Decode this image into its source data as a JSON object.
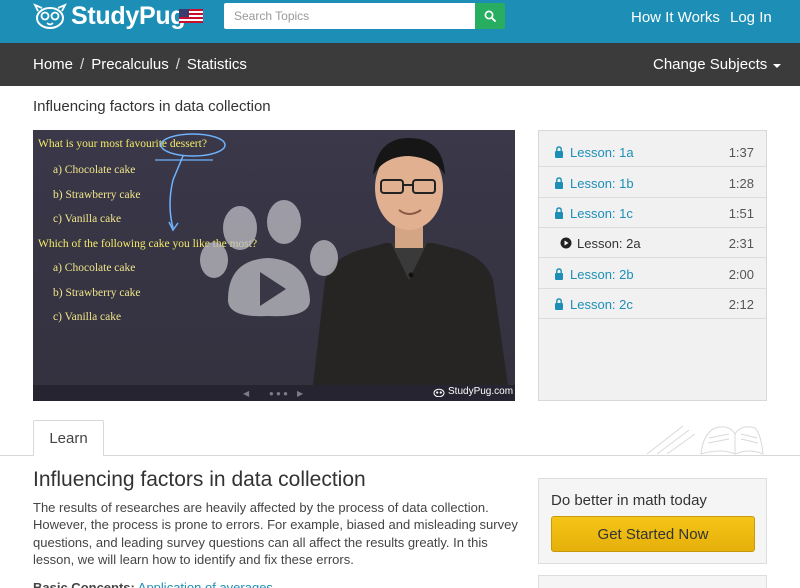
{
  "header": {
    "logo_text": "StudyPug",
    "search_placeholder": "Search Topics",
    "nav": {
      "how_it_works": "How It Works",
      "login": "Log In"
    },
    "brand_color": "#1d8fb6"
  },
  "breadcrumb": {
    "items": [
      "Home",
      "Precalculus",
      "Statistics"
    ],
    "separator": "/",
    "change_subjects": "Change Subjects"
  },
  "page": {
    "heading": "Influencing factors in data collection"
  },
  "video": {
    "lines": [
      {
        "text": "What is your most favourite dessert?",
        "kind": "question"
      },
      {
        "text": "a) Chocolate cake",
        "kind": "option"
      },
      {
        "text": "b) Strawberry cake",
        "kind": "option"
      },
      {
        "text": "c) Vanilla cake",
        "kind": "option"
      },
      {
        "text": "Which of the following cake you like the most?",
        "kind": "question"
      },
      {
        "text": "a) Chocolate cake",
        "kind": "option"
      },
      {
        "text": "b) Strawberry cake",
        "kind": "option"
      },
      {
        "text": "c) Vanilla cake",
        "kind": "option"
      }
    ],
    "watermark": "StudyPug.com"
  },
  "lessons": [
    {
      "name": "Lesson: 1a",
      "time": "1:37",
      "locked": true
    },
    {
      "name": "Lesson: 1b",
      "time": "1:28",
      "locked": true
    },
    {
      "name": "Lesson: 1c",
      "time": "1:51",
      "locked": true
    },
    {
      "name": "Lesson: 2a",
      "time": "2:31",
      "locked": false
    },
    {
      "name": "Lesson: 2b",
      "time": "2:00",
      "locked": true
    },
    {
      "name": "Lesson: 2c",
      "time": "2:12",
      "locked": true
    }
  ],
  "tabs": {
    "learn": "Learn"
  },
  "content": {
    "title": "Influencing factors in data collection",
    "description": "The results of researches are heavily affected by the process of data collection. However, the process is prone to errors. For example, biased and misleading survey questions, and leading survey questions can all affect the results greatly. In this lesson, we will learn how to identify and fix these errors.",
    "basic_concepts_label": "Basic Concepts:",
    "basic_concepts_link": "Application of averages"
  },
  "cta": {
    "title": "Do better in math today",
    "button": "Get Started Now"
  }
}
